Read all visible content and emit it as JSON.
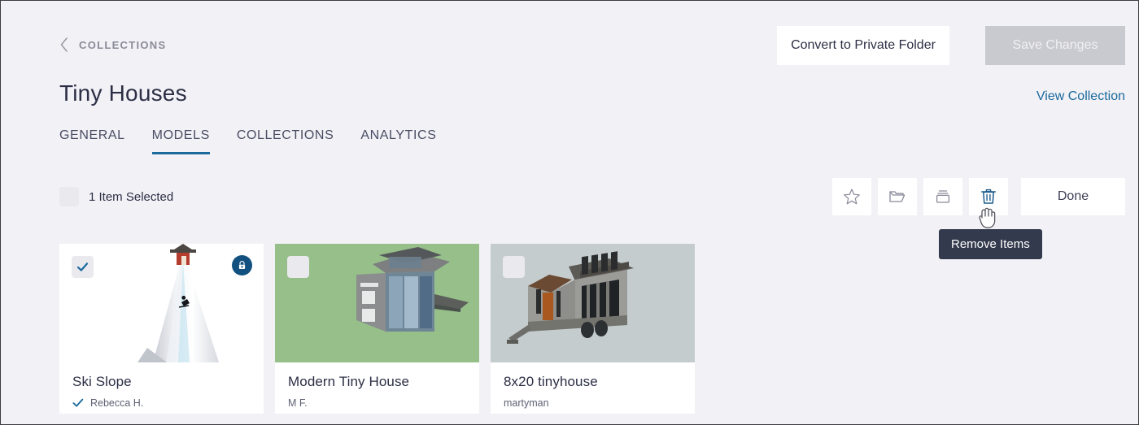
{
  "breadcrumb": {
    "label": "COLLECTIONS",
    "icon": "chevron-left-icon"
  },
  "header": {
    "title": "Tiny Houses",
    "convert_label": "Convert to Private Folder",
    "save_label": "Save Changes",
    "view_collection_label": "View Collection"
  },
  "tabs": [
    {
      "label": "GENERAL",
      "active": false
    },
    {
      "label": "MODELS",
      "active": true
    },
    {
      "label": "COLLECTIONS",
      "active": false
    },
    {
      "label": "ANALYTICS",
      "active": false
    }
  ],
  "selection": {
    "count_label": "1 Item Selected",
    "checkbox_checked": false
  },
  "toolbar": {
    "buttons": [
      {
        "name": "favorite-button",
        "icon": "star-icon",
        "active": false
      },
      {
        "name": "move-to-folder-button",
        "icon": "folder-icon",
        "active": false
      },
      {
        "name": "add-to-collection-button",
        "icon": "collection-stack-icon",
        "active": false
      },
      {
        "name": "remove-items-button",
        "icon": "trash-icon",
        "active": true
      }
    ],
    "done_label": "Done",
    "tooltip": "Remove Items"
  },
  "cards": [
    {
      "title": "Ski Slope",
      "author": "Rebecca H.",
      "author_verified": true,
      "selected": true,
      "private": true,
      "thumb_bg": "#ffffff",
      "thumb_art": "ski-slope"
    },
    {
      "title": "Modern Tiny House",
      "author": "M F.",
      "author_verified": false,
      "selected": false,
      "private": false,
      "thumb_bg": "#96bf8a",
      "thumb_art": "modern-tiny-house"
    },
    {
      "title": "8x20 tinyhouse",
      "author": "martyman",
      "author_verified": false,
      "selected": false,
      "private": false,
      "thumb_bg": "#c4ccce",
      "thumb_art": "tiny-house-trailer"
    }
  ],
  "colors": {
    "accent_blue": "#1b6a9c",
    "lock_navy": "#11507f",
    "page_bg": "#f2f1f6",
    "tooltip_bg": "#343a4d"
  }
}
